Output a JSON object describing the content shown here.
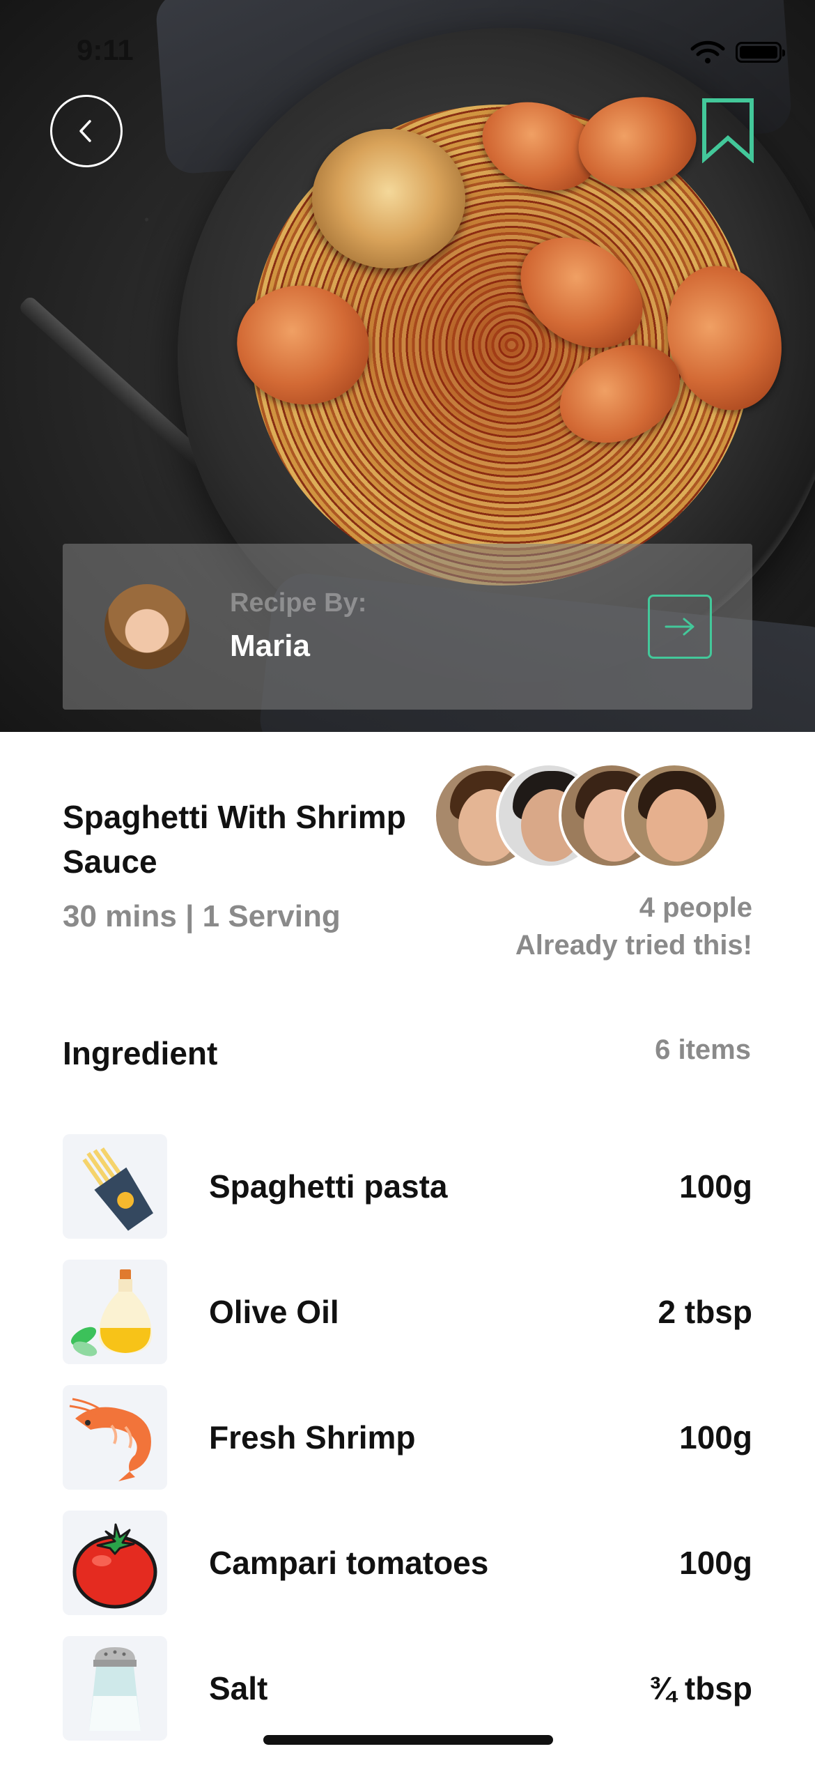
{
  "status_bar": {
    "time": "9:11"
  },
  "hero": {
    "image_icon": "spaghetti-shrimp-photo",
    "back_icon": "chevron-left-icon",
    "bookmark_icon": "bookmark-icon",
    "accent_color": "#43c89a"
  },
  "author": {
    "label": "Recipe By:",
    "name": "Maria",
    "arrow_icon": "arrow-right-icon"
  },
  "recipe": {
    "title": "Spaghetti With Shrimp Sauce",
    "meta": "30 mins | 1 Serving",
    "tried_count": "4 people",
    "tried_caption": "Already tried this!"
  },
  "ingredients": {
    "heading": "Ingredient",
    "count": "6 items",
    "items": [
      {
        "name": "Spaghetti pasta",
        "qty": "100g",
        "icon": "spaghetti-pack-icon"
      },
      {
        "name": "Olive Oil",
        "qty": "2 tbsp",
        "icon": "olive-oil-bottle-icon"
      },
      {
        "name": "Fresh Shrimp",
        "qty": "100g",
        "icon": "shrimp-icon"
      },
      {
        "name": "Campari tomatoes",
        "qty": "100g",
        "icon": "tomato-icon"
      },
      {
        "name": "Salt",
        "qty": "¾ tbsp",
        "icon": "salt-shaker-icon"
      }
    ]
  }
}
